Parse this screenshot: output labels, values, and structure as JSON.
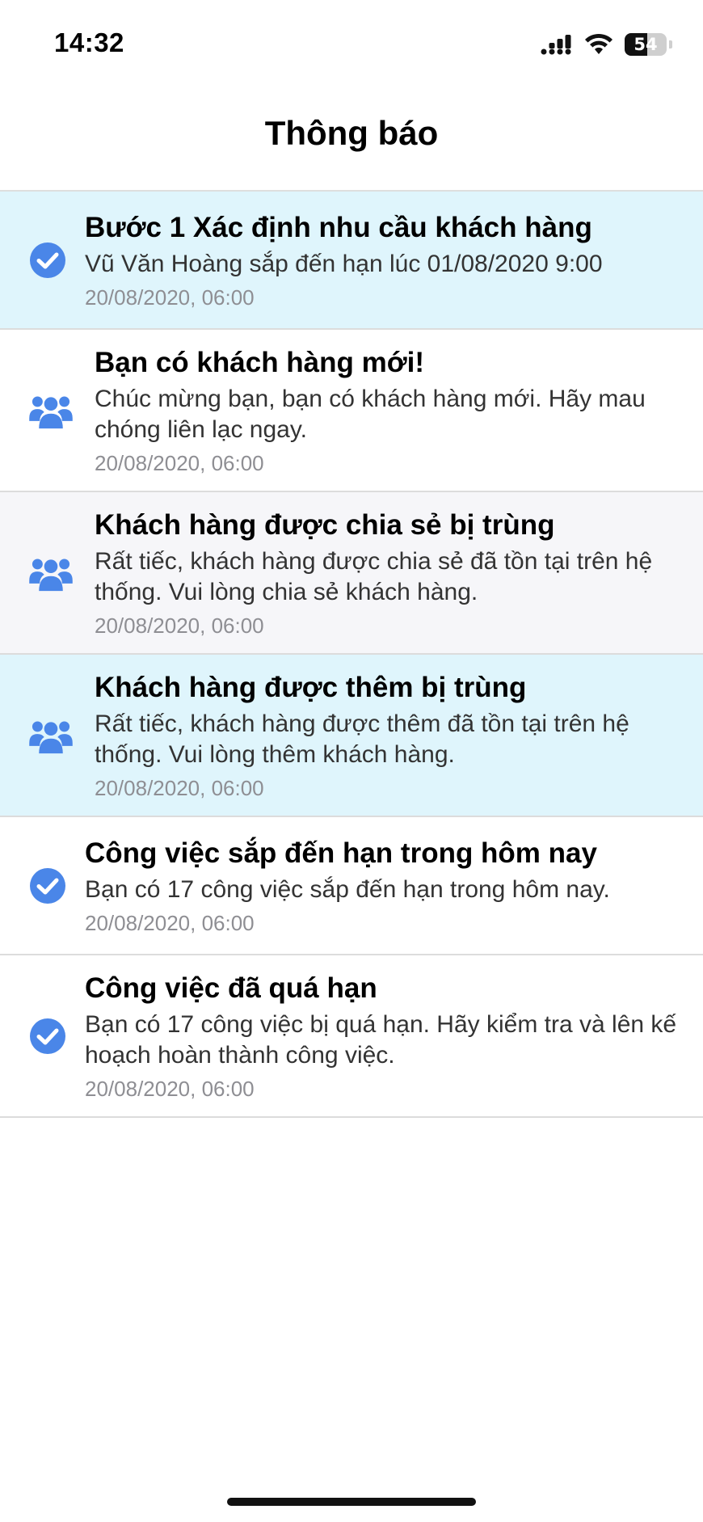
{
  "status_bar": {
    "time": "14:32",
    "battery_level": "54",
    "battery_fill_fraction": 0.54
  },
  "header": {
    "title": "Thông báo"
  },
  "notifications": [
    {
      "icon": "check-circle-icon",
      "title": "Bước 1 Xác định nhu cầu khách hàng",
      "text": "Vũ Văn Hoàng sắp đến hạn lúc 01/08/2020 9:00",
      "time": "20/08/2020, 06:00",
      "background": "#dff5fc"
    },
    {
      "icon": "users-icon",
      "title": "Bạn có khách hàng mới!",
      "text": "Chúc mừng bạn, bạn có khách hàng mới. Hãy mau chóng liên lạc ngay.",
      "time": "20/08/2020, 06:00",
      "background": "#ffffff"
    },
    {
      "icon": "users-icon",
      "title": "Khách hàng được chia sẻ bị trùng",
      "text": "Rất tiếc, khách hàng được chia sẻ đã tồn tại trên hệ thống. Vui lòng chia sẻ khách hàng.",
      "time": "20/08/2020, 06:00",
      "background": "#f6f6f9"
    },
    {
      "icon": "users-icon",
      "title": "Khách hàng được thêm bị trùng",
      "text": "Rất tiếc, khách hàng được thêm đã tồn tại trên hệ thống. Vui lòng thêm khách hàng.",
      "time": "20/08/2020, 06:00",
      "background": "#dff5fc"
    },
    {
      "icon": "check-circle-icon",
      "title": "Công việc sắp đến hạn trong hôm nay",
      "text": "Bạn có 17 công việc sắp đến hạn trong hôm nay.",
      "time": "20/08/2020, 06:00",
      "background": "#ffffff"
    },
    {
      "icon": "check-circle-icon",
      "title": "Công việc đã quá hạn",
      "text": "Bạn có 17 công việc bị quá hạn. Hãy kiểm tra và lên kế hoạch hoàn thành công việc.",
      "time": "20/08/2020, 06:00",
      "background": "#ffffff"
    }
  ],
  "colors": {
    "accent": "#4a86e8"
  }
}
